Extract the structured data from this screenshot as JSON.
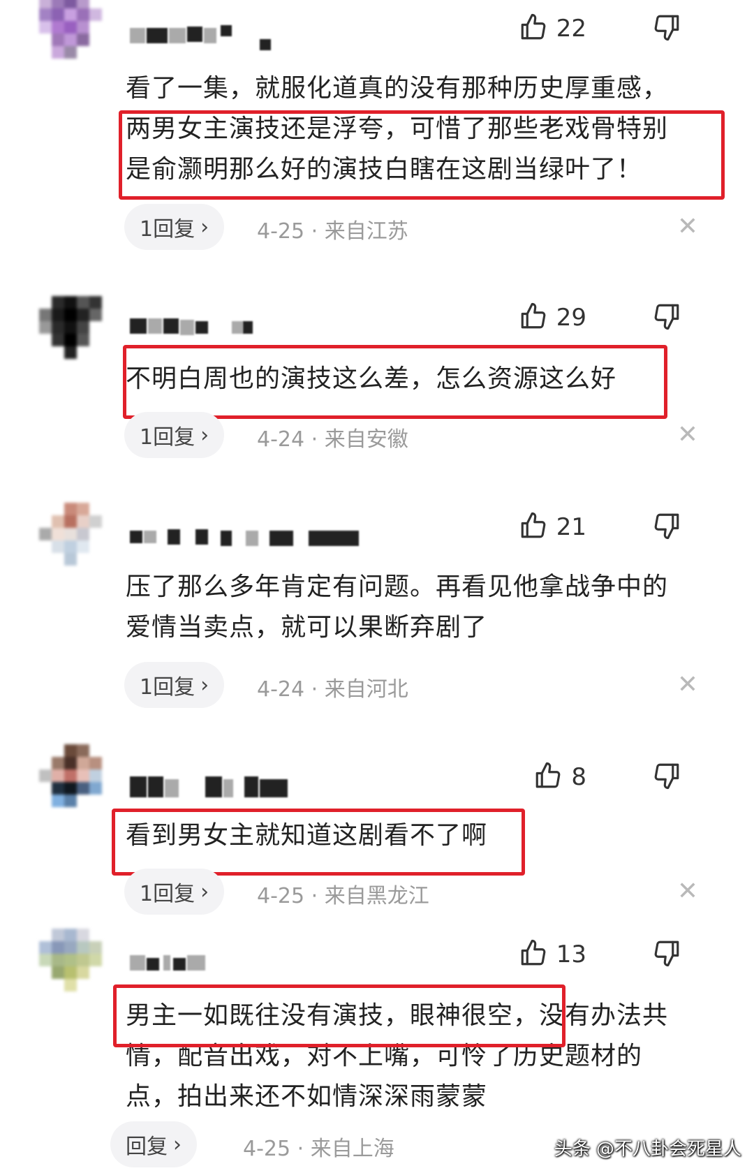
{
  "comments": [
    {
      "likes": "22",
      "text_lines": [
        "看了一集，就服化道真的没有那种历史厚重感，",
        "两男女主演技还是浮夸，可惜了那些老戏骨特别",
        "是俞灏明那么好的演技白瞎在这剧当绿叶了！"
      ],
      "reply_label": "1回复",
      "date": "4-25",
      "location": "来自江苏"
    },
    {
      "likes": "29",
      "text_lines": [
        "不明白周也的演技这么差，怎么资源这么好"
      ],
      "reply_label": "1回复",
      "date": "4-24",
      "location": "来自安徽"
    },
    {
      "likes": "21",
      "text_lines": [
        "压了那么多年肯定有问题。再看见他拿战争中的",
        "爱情当卖点，就可以果断弃剧了"
      ],
      "reply_label": "1回复",
      "date": "4-24",
      "location": "来自河北"
    },
    {
      "likes": "8",
      "text_lines": [
        "看到男女主就知道这剧看不了啊"
      ],
      "reply_label": "1回复",
      "date": "4-25",
      "location": "来自黑龙江"
    },
    {
      "likes": "13",
      "text_lines": [
        "男主一如既往没有演技，眼神很空，没有办法共",
        "情，配音出戏，对不上嘴，可怜了历史题材的",
        "点，拍出来还不如情深深雨蒙蒙"
      ],
      "reply_label": "回复",
      "date": "4-25",
      "location": "来自上海"
    }
  ],
  "separator": "·",
  "close_symbol": "✕",
  "chevron_symbol": "›",
  "watermark": "头条 @不八卦会死星人",
  "colors": {
    "highlight_box": "#e0202a",
    "meta_text": "#9a9a9a",
    "pill_bg": "#f3f3f5"
  }
}
